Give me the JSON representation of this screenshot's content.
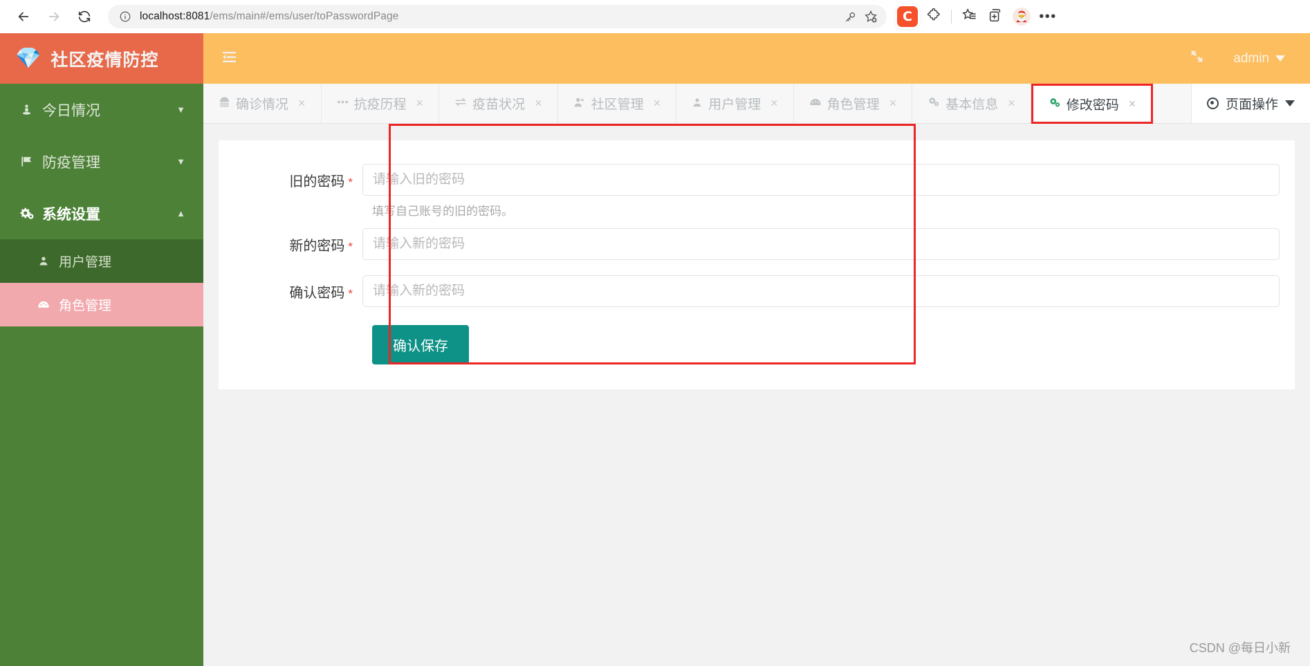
{
  "browser": {
    "back_icon": "back-arrow-icon",
    "forward_icon": "forward-arrow-icon",
    "reload_icon": "reload-icon",
    "url_host": "localhost:8081",
    "url_path": "/ems/main#/ems/user/toPasswordPage",
    "info_icon": "info-circle-icon",
    "key_icon": "key-icon",
    "favorite_icon": "star-plus-icon",
    "extension_badge": "C",
    "puzzle_icon": "extensions-puzzle-icon",
    "collections_icon": "collections-icon",
    "favorites_list_icon": "favorites-list-icon",
    "profile_icon": "profile-avatar-icon",
    "more_icon": "more-options-icon"
  },
  "header": {
    "logo_icon": "diamond-gem-icon",
    "title": "社区疫情防控",
    "collapse_icon": "menu-collapse-icon",
    "fullscreen_icon": "fullscreen-icon",
    "user_name": "admin"
  },
  "sidebar": {
    "items": [
      {
        "label": "今日情况",
        "icon": "person-pin-icon",
        "arrow": "▼",
        "active": false
      },
      {
        "label": "防疫管理",
        "icon": "flag-icon",
        "arrow": "▼",
        "active": false
      },
      {
        "label": "系统设置",
        "icon": "gears-icon",
        "arrow": "▲",
        "active": true
      }
    ],
    "subitems": [
      {
        "label": "用户管理",
        "icon": "user-icon",
        "selected": false
      },
      {
        "label": "角色管理",
        "icon": "dashboard-icon",
        "selected": true
      }
    ]
  },
  "tabs": [
    {
      "label": "确诊情况",
      "icon": "hospital-icon",
      "close": "×",
      "active": false
    },
    {
      "label": "抗疫历程",
      "icon": "signal-icon",
      "close": "×",
      "active": false
    },
    {
      "label": "疫苗状况",
      "icon": "exchange-icon",
      "close": "×",
      "active": false
    },
    {
      "label": "社区管理",
      "icon": "user-times-icon",
      "close": "×",
      "active": false
    },
    {
      "label": "用户管理",
      "icon": "user-icon",
      "close": "×",
      "active": false
    },
    {
      "label": "角色管理",
      "icon": "dashboard-icon",
      "close": "×",
      "active": false
    },
    {
      "label": "基本信息",
      "icon": "gears-icon",
      "close": "×",
      "active": false
    },
    {
      "label": "修改密码",
      "icon": "gears-green-icon",
      "close": "×",
      "active": true
    }
  ],
  "tab_actions": {
    "label": "页面操作",
    "icon": "target-dot-icon",
    "caret": "caret-down-icon"
  },
  "form": {
    "fields": [
      {
        "label": "旧的密码",
        "required": "*",
        "placeholder": "请输入旧的密码",
        "value": "",
        "help": "填写自己账号的旧的密码。"
      },
      {
        "label": "新的密码",
        "required": "*",
        "placeholder": "请输入新的密码",
        "value": "",
        "help": ""
      },
      {
        "label": "确认密码",
        "required": "*",
        "placeholder": "请输入新的密码",
        "value": "",
        "help": ""
      }
    ],
    "submit_label": "确认保存"
  },
  "watermark": "CSDN @每日小新",
  "colors": {
    "brand_orange": "#e8694a",
    "top_bar": "#fcbe5f",
    "sidebar_green": "#4c8137",
    "sidebar_sub": "#3d6a2c",
    "selected_pink": "#f2a9ae",
    "submit_teal": "#0e9186",
    "annotation_red": "#ec2626"
  }
}
